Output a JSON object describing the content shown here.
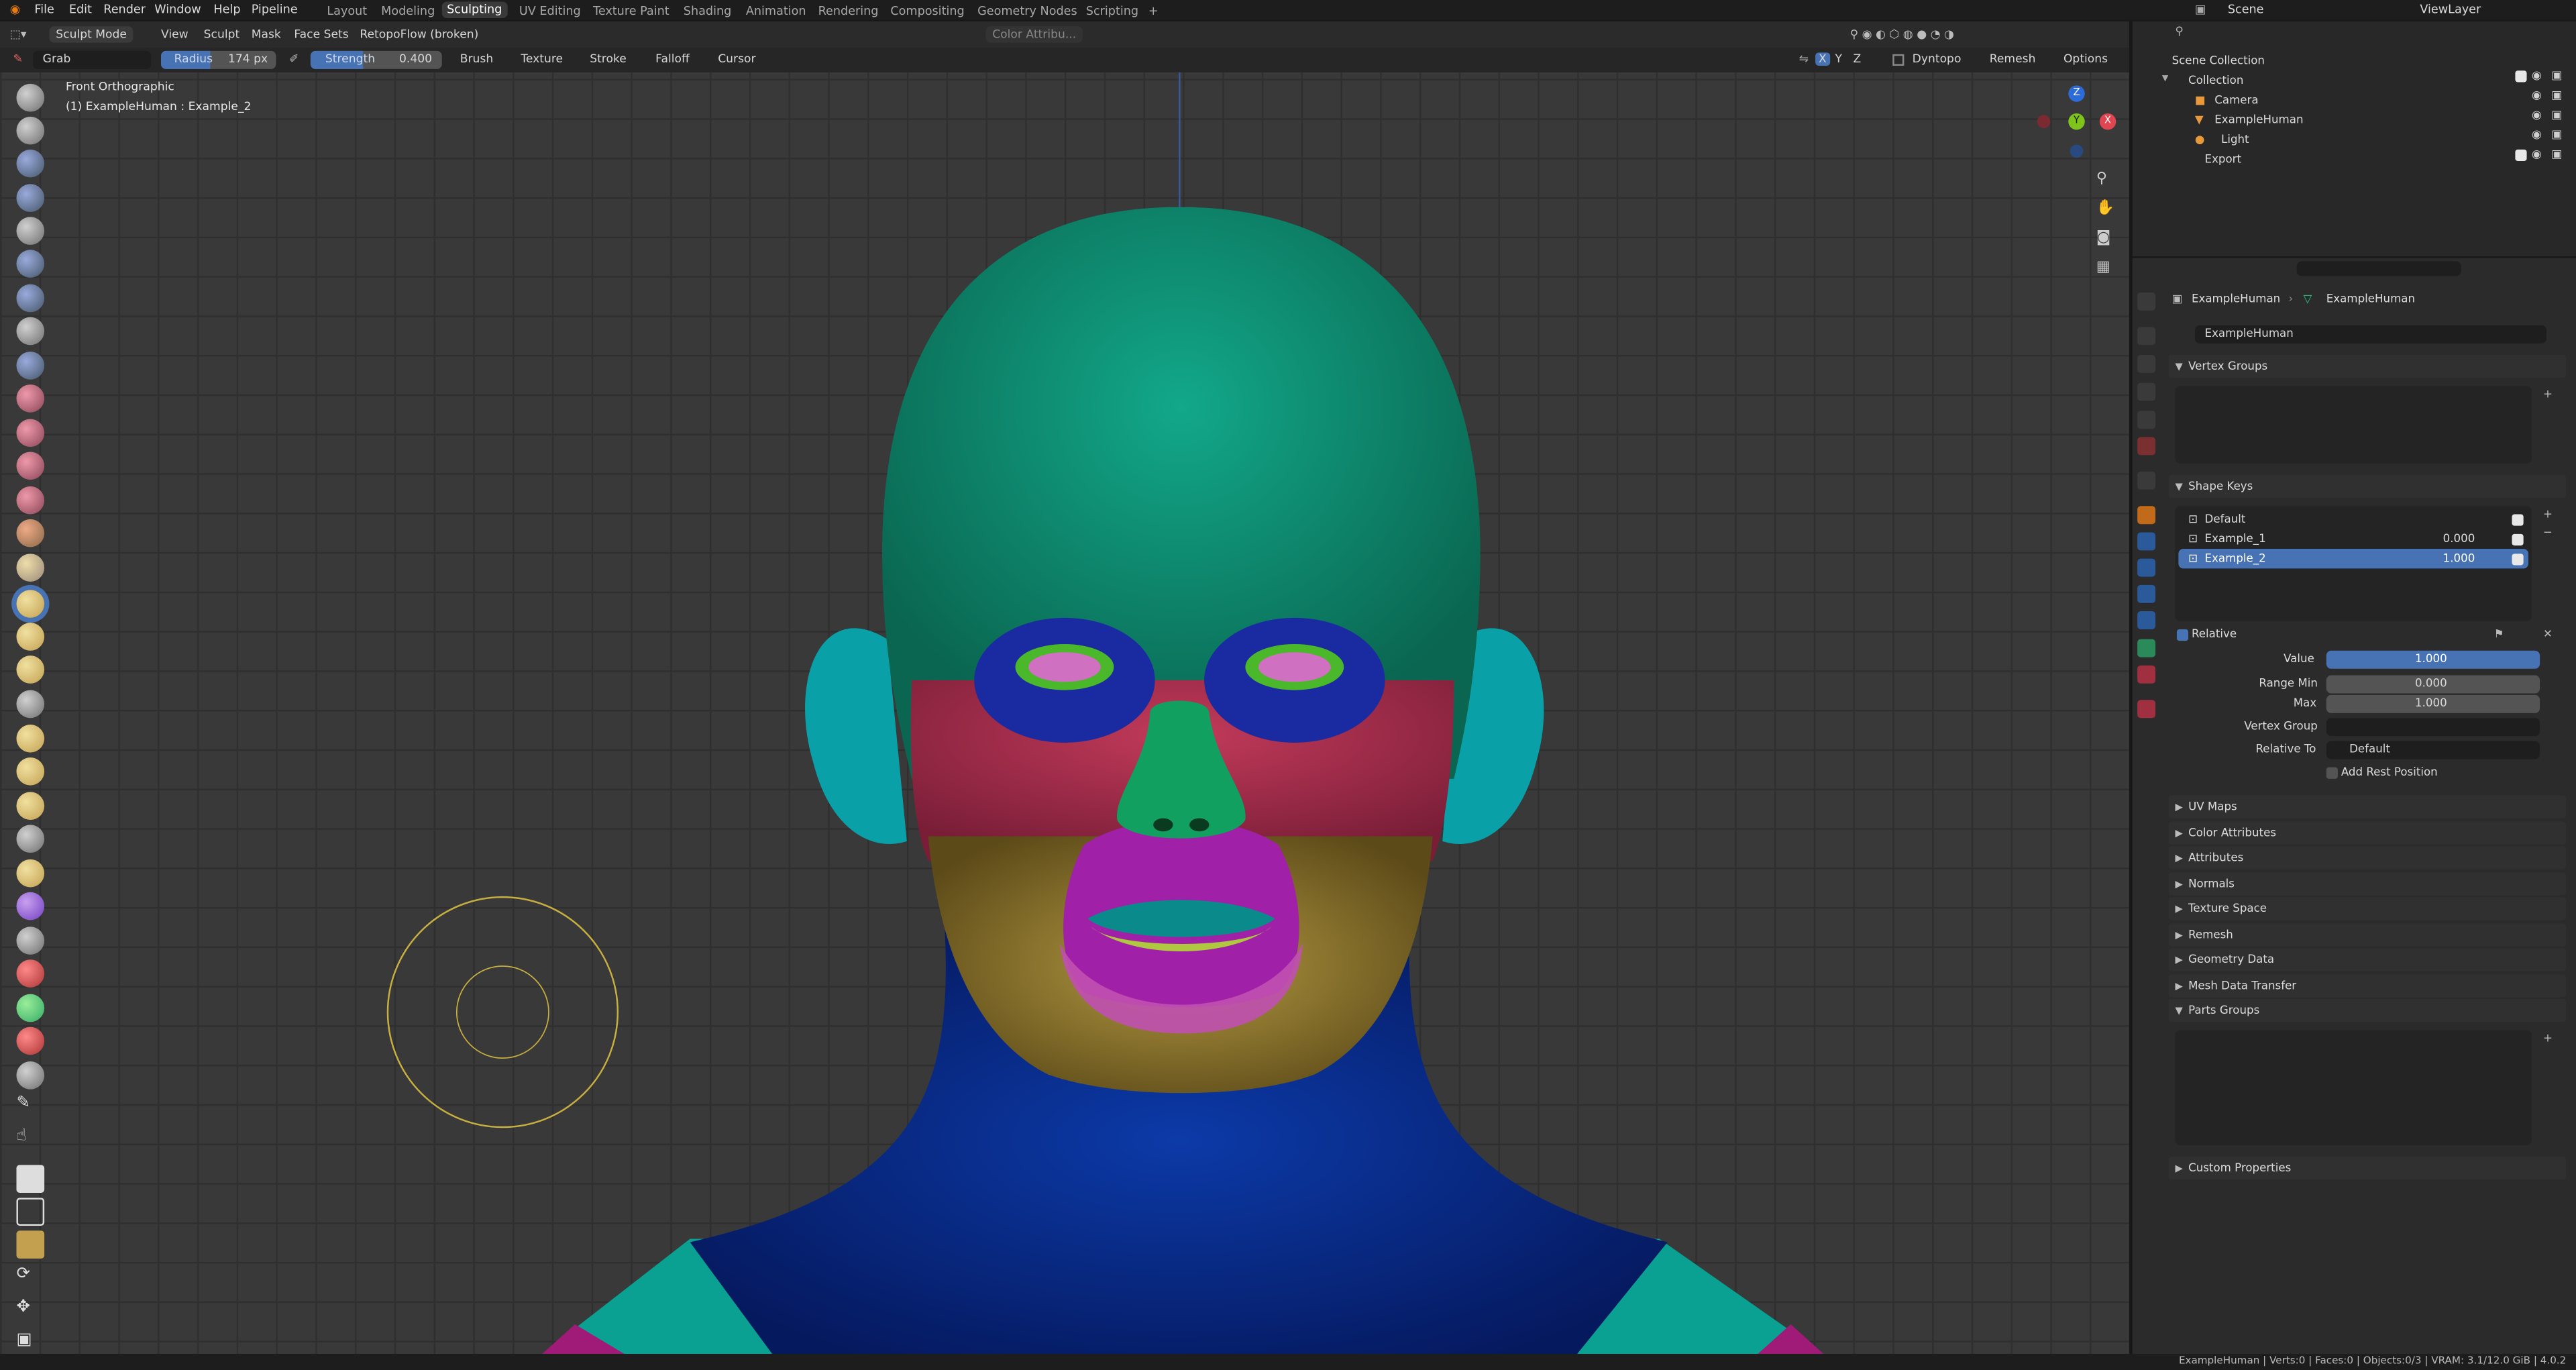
{
  "menu": [
    "File",
    "Edit",
    "Render",
    "Window",
    "Help",
    "Pipeline"
  ],
  "workspaces": [
    "Layout",
    "Modeling",
    "Sculpting",
    "UV Editing",
    "Texture Paint",
    "Shading",
    "Animation",
    "Rendering",
    "Compositing",
    "Geometry Nodes",
    "Scripting",
    "+"
  ],
  "active_workspace": "Sculpting",
  "scene": "Scene",
  "view_layer": "ViewLayer",
  "header": {
    "mode": "Sculpt Mode",
    "items": [
      "View",
      "Sculpt",
      "Mask",
      "Face Sets",
      "RetopoFlow (broken)"
    ],
    "color_attr": "Color Attribu..."
  },
  "tool": {
    "brush": "Grab",
    "radius_label": "Radius",
    "radius": "174 px",
    "strength_label": "Strength",
    "strength": "0.400",
    "menus": [
      "Brush",
      "Texture",
      "Stroke",
      "Falloff",
      "Cursor"
    ],
    "axes": [
      "X",
      "Y",
      "Z"
    ],
    "dyntopo": "Dyntopo",
    "remesh": "Remesh",
    "options": "Options"
  },
  "viewport": {
    "view_name": "Front Orthographic",
    "object_info": "(1) ExampleHuman : Example_2",
    "gizmo": {
      "z": "Z",
      "y": "Y",
      "x": "X"
    }
  },
  "outliner": {
    "root": "Scene Collection",
    "collection": "Collection",
    "items": [
      "Camera",
      "ExampleHuman",
      "Light"
    ],
    "export": "Export"
  },
  "properties": {
    "breadcrumb_obj": "ExampleHuman",
    "breadcrumb_mesh": "ExampleHuman",
    "mesh_name": "ExampleHuman",
    "vertex_groups": "Vertex Groups",
    "shape_keys": "Shape Keys",
    "keys": [
      {
        "name": "Default",
        "value": ""
      },
      {
        "name": "Example_1",
        "value": "0.000"
      },
      {
        "name": "Example_2",
        "value": "1.000"
      }
    ],
    "relative": "Relative",
    "value_label": "Value",
    "value": "1.000",
    "range_min_label": "Range Min",
    "range_min": "0.000",
    "max_label": "Max",
    "max": "1.000",
    "vertex_group_label": "Vertex Group",
    "relative_to_label": "Relative To",
    "relative_to": "Default",
    "add_rest": "Add Rest Position",
    "sections": [
      "UV Maps",
      "Color Attributes",
      "Attributes",
      "Normals",
      "Texture Space",
      "Remesh",
      "Geometry Data",
      "Mesh Data Transfer"
    ],
    "parts_groups": "Parts Groups",
    "custom_props": "Custom Properties"
  },
  "status": "ExampleHuman | Verts:0 | Faces:0 | Objects:0/3 | VRAM: 3.1/12.0 GiB | 4.0.2",
  "colors": {
    "accent": "#4772b3",
    "head_green": "#0e8a6a",
    "face_red": "#b0304f",
    "neck_blue": "#0a2a8a",
    "lips": "#c040c0",
    "jaw": "#a08a3a",
    "ear": "#0aa0a8"
  }
}
